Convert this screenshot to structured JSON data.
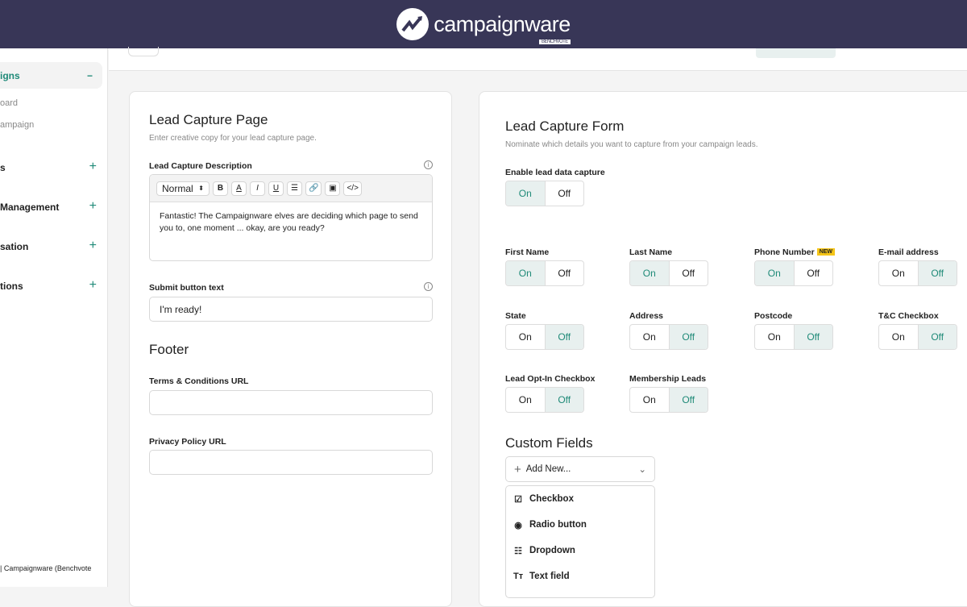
{
  "header": {
    "brand": "campaignware",
    "by": "BENCHVOTE"
  },
  "sidebar": {
    "active": "igns",
    "subitems": [
      "oard",
      "ampaign"
    ],
    "items": [
      "s",
      "Management",
      "sation",
      "tions"
    ],
    "footer": "| Campaignware (Benchvote"
  },
  "lead_page": {
    "title": "Lead Capture Page",
    "subtitle": "Enter creative copy for your lead capture page.",
    "description_label": "Lead Capture Description",
    "format": "Normal",
    "description": "Fantastic! The Campaignware elves are deciding which page to send you to, one moment ... okay, are you ready?",
    "submit_label": "Submit button text",
    "submit_value": "I'm ready!",
    "footer_title": "Footer",
    "terms_label": "Terms & Conditions URL",
    "terms_value": "",
    "privacy_label": "Privacy Policy URL",
    "privacy_value": ""
  },
  "lead_form": {
    "title": "Lead Capture Form",
    "subtitle": "Nominate which details you want to capture from your campaign leads.",
    "enable_label": "Enable lead data capture",
    "enable": "On",
    "on": "On",
    "off": "Off",
    "new_badge": "NEW",
    "fields": [
      {
        "label": "First Name",
        "value": "On"
      },
      {
        "label": "Last Name",
        "value": "On"
      },
      {
        "label": "Phone Number",
        "value": "On"
      },
      {
        "label": "E-mail address",
        "value": "Off"
      },
      {
        "label": "State",
        "value": "Off"
      },
      {
        "label": "Address",
        "value": "Off"
      },
      {
        "label": "Postcode",
        "value": "Off"
      },
      {
        "label": "T&C Checkbox",
        "value": "Off"
      },
      {
        "label": "Lead Opt-In Checkbox",
        "value": "Off"
      },
      {
        "label": "Membership Leads",
        "value": "Off"
      }
    ],
    "custom_title": "Custom Fields",
    "add_new": "Add New...",
    "menu": [
      "Checkbox",
      "Radio button",
      "Dropdown",
      "Text field"
    ]
  }
}
